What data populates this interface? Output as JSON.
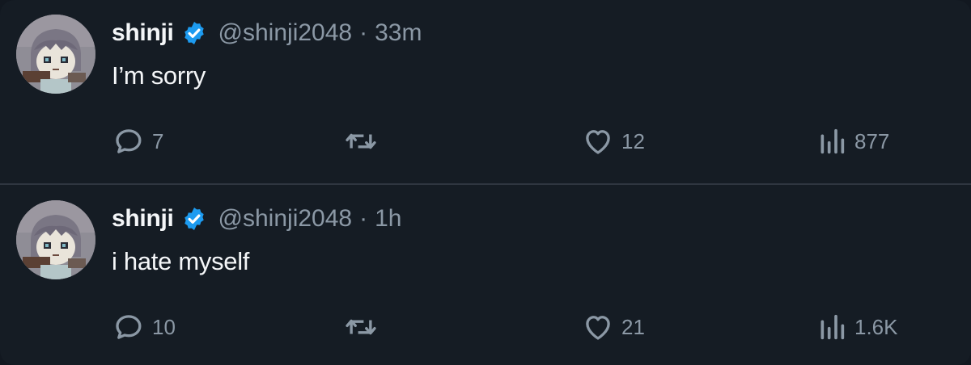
{
  "colors": {
    "background": "#151c24",
    "text_primary": "#f4f6f8",
    "text_secondary": "#8b98a5",
    "verified_badge": "#1d9bf0",
    "divider": "#2f3640"
  },
  "tweets": [
    {
      "author": {
        "name": "shinji",
        "handle": "@shinji2048",
        "verified": true,
        "badge_icon": "verified-badge-icon"
      },
      "separator": "·",
      "time": "33m",
      "text": "I’m sorry",
      "stats": {
        "replies": "7",
        "retweets": "",
        "likes": "12",
        "views": "877"
      }
    },
    {
      "author": {
        "name": "shinji",
        "handle": "@shinji2048",
        "verified": true,
        "badge_icon": "verified-badge-icon"
      },
      "separator": "·",
      "time": "1h",
      "text": "i hate myself",
      "stats": {
        "replies": "10",
        "retweets": "",
        "likes": "21",
        "views": "1.6K"
      }
    }
  ],
  "icons": {
    "reply": "reply-icon",
    "retweet": "retweet-icon",
    "like": "heart-icon",
    "views": "views-chart-icon",
    "avatar": "avatar-image"
  }
}
